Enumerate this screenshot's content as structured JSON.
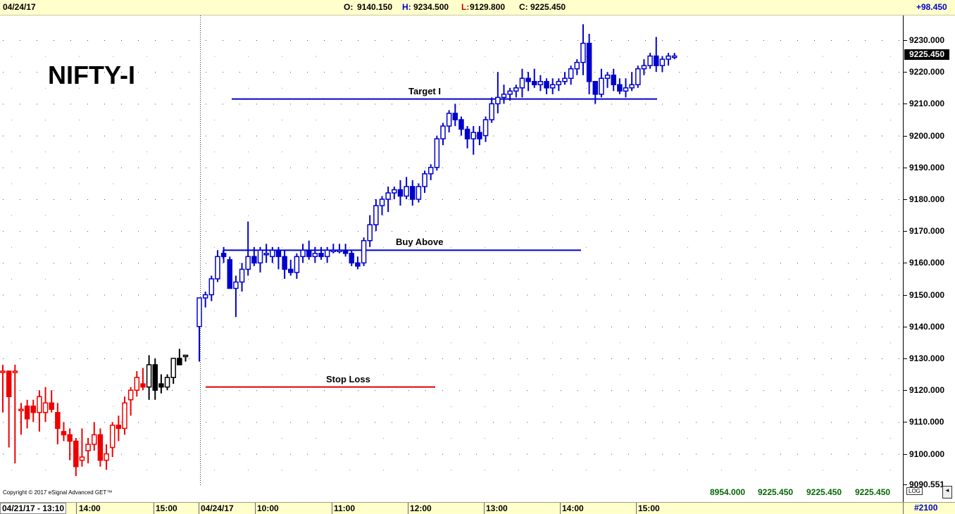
{
  "header": {
    "date": "04/24/17",
    "open_label": "O:",
    "open": "9140.150",
    "high_label": "H:",
    "high": "9234.500",
    "low_label": "L:",
    "low": "9129.800",
    "close_label": "C:",
    "close": "9225.450",
    "change": "+98.450"
  },
  "symbol": "NIFTY-I",
  "copyright": "Copyright © 2017 eSignal Advanced GET™",
  "price_flag": "9225.450",
  "bottom_values": [
    "8954.000",
    "9225.450",
    "9225.450",
    "9225.450"
  ],
  "log_label": "LOG",
  "bar_count": "#2100",
  "time_axis": {
    "start": "04/21/17 - 13:10",
    "labels": [
      "14:00",
      "15:00",
      "04/24/17",
      "10:00",
      "11:00",
      "12:00",
      "13:00",
      "14:00",
      "15:00"
    ]
  },
  "chart_data": {
    "type": "candlestick",
    "ylim": [
      9090.551,
      9235
    ],
    "yticks": [
      "9230.000",
      "9220.000",
      "9210.000",
      "9200.000",
      "9190.000",
      "9180.000",
      "9170.000",
      "9160.000",
      "9150.000",
      "9140.000",
      "9130.000",
      "9120.000",
      "9110.000",
      "9100.000",
      "9090.551"
    ],
    "annotations": [
      {
        "label": "Target I",
        "price": 9211.5,
        "color": "#0000cc"
      },
      {
        "label": "Buy Above",
        "price": 9164,
        "color": "#0000cc"
      },
      {
        "label": "Stop Loss",
        "price": 9121,
        "color": "#dd0000"
      }
    ],
    "day1_color": "#ee0000",
    "day1_late_color": "#000000",
    "day2_color": "#0000cc",
    "day1": [
      [
        9126,
        9128,
        9113,
        9126
      ],
      [
        9126,
        9126,
        9102,
        9118
      ],
      [
        9126,
        9128,
        9097,
        9126
      ],
      [
        9114,
        9116,
        9106,
        9114
      ],
      [
        9115,
        9117,
        9108,
        9111
      ],
      [
        9115,
        9117,
        9110,
        9113
      ],
      [
        9113,
        9120,
        9107,
        9118
      ],
      [
        9113,
        9121,
        9110,
        9116
      ],
      [
        9116,
        9120,
        9113,
        9114
      ],
      [
        9113,
        9116,
        9103,
        9108
      ],
      [
        9107,
        9110,
        9104,
        9106
      ],
      [
        9106,
        9108,
        9098,
        9104
      ],
      [
        9104,
        9105,
        9093,
        9096
      ],
      [
        9098,
        9108,
        9096,
        9099
      ],
      [
        9101,
        9105,
        9097,
        9103
      ],
      [
        9103,
        9110,
        9101,
        9106
      ],
      [
        9106,
        9108,
        9096,
        9098
      ],
      [
        9098,
        9103,
        9095,
        9100
      ],
      [
        9102,
        9110,
        9099,
        9109
      ],
      [
        9109,
        9112,
        9104,
        9108
      ],
      [
        9108,
        9118,
        9106,
        9116
      ],
      [
        9117,
        9121,
        9112,
        9120
      ],
      [
        9120,
        9126,
        9118,
        9124
      ],
      [
        9122,
        9127,
        9120,
        9121
      ],
      [
        9121,
        9131,
        9117,
        9128
      ],
      [
        9128,
        9130,
        9117,
        9120
      ],
      [
        9122,
        9125,
        9119,
        9121
      ],
      [
        9121,
        9125,
        9120,
        9124
      ],
      [
        9124,
        9130,
        9122,
        9130
      ],
      [
        9130,
        9133,
        9128,
        9128
      ],
      [
        9131,
        9131,
        9129,
        9131
      ]
    ],
    "day2": [
      [
        9140,
        9149,
        9129,
        9149
      ],
      [
        9149,
        9151,
        9146,
        9150
      ],
      [
        9150,
        9156,
        9148,
        9155
      ],
      [
        9155,
        9164,
        9154,
        9162
      ],
      [
        9163,
        9165,
        9160,
        9162
      ],
      [
        9161,
        9162,
        9152,
        9152
      ],
      [
        9152,
        9156,
        9143,
        9154
      ],
      [
        9154,
        9160,
        9151,
        9158
      ],
      [
        9158,
        9173,
        9156,
        9162
      ],
      [
        9162,
        9165,
        9159,
        9160
      ],
      [
        9160,
        9165,
        9157,
        9164
      ],
      [
        9163,
        9166,
        9160,
        9163
      ],
      [
        9162,
        9165,
        9160,
        9164
      ],
      [
        9164,
        9165,
        9158,
        9162
      ],
      [
        9162,
        9164,
        9155,
        9158
      ],
      [
        9158,
        9161,
        9156,
        9157
      ],
      [
        9157,
        9163,
        9155,
        9162
      ],
      [
        9162,
        9166,
        9160,
        9164
      ],
      [
        9164,
        9167,
        9161,
        9162
      ],
      [
        9162,
        9165,
        9160,
        9163
      ],
      [
        9163,
        9165,
        9161,
        9162
      ],
      [
        9162,
        9165,
        9160,
        9164
      ],
      [
        9164,
        9166,
        9163,
        9164
      ],
      [
        9164,
        9166,
        9163,
        9164
      ],
      [
        9164,
        9166,
        9162,
        9163
      ],
      [
        9163,
        9164,
        9159,
        9160
      ],
      [
        9160,
        9162,
        9158,
        9159
      ],
      [
        9160,
        9168,
        9159,
        9167
      ],
      [
        9167,
        9175,
        9165,
        9172
      ],
      [
        9172,
        9180,
        9170,
        9178
      ],
      [
        9178,
        9181,
        9175,
        9180
      ],
      [
        9180,
        9184,
        9176,
        9182
      ],
      [
        9182,
        9184,
        9180,
        9183
      ],
      [
        9183,
        9186,
        9178,
        9181
      ],
      [
        9181,
        9187,
        9180,
        9184
      ],
      [
        9184,
        9186,
        9178,
        9180
      ],
      [
        9180,
        9185,
        9179,
        9184
      ],
      [
        9184,
        9189,
        9182,
        9188
      ],
      [
        9188,
        9191,
        9186,
        9190
      ],
      [
        9190,
        9200,
        9189,
        9199
      ],
      [
        9199,
        9204,
        9197,
        9203
      ],
      [
        9203,
        9208,
        9201,
        9207
      ],
      [
        9207,
        9210,
        9203,
        9205
      ],
      [
        9205,
        9206,
        9200,
        9202
      ],
      [
        9202,
        9203,
        9196,
        9199
      ],
      [
        9199,
        9203,
        9194,
        9201
      ],
      [
        9201,
        9203,
        9197,
        9199
      ],
      [
        9200,
        9206,
        9198,
        9205
      ],
      [
        9205,
        9212,
        9204,
        9210
      ],
      [
        9210,
        9220,
        9207,
        9212
      ],
      [
        9212,
        9216,
        9210,
        9213
      ],
      [
        9213,
        9215,
        9211,
        9214
      ],
      [
        9214,
        9216,
        9212,
        9215
      ],
      [
        9215,
        9221,
        9212,
        9218
      ],
      [
        9218,
        9220,
        9214,
        9217
      ],
      [
        9217,
        9221,
        9215,
        9216
      ],
      [
        9216,
        9219,
        9214,
        9217
      ],
      [
        9217,
        9218,
        9213,
        9215
      ],
      [
        9215,
        9218,
        9213,
        9216
      ],
      [
        9216,
        9218,
        9214,
        9217
      ],
      [
        9217,
        9220,
        9216,
        9218
      ],
      [
        9218,
        9222,
        9216,
        9221
      ],
      [
        9221,
        9224,
        9219,
        9223
      ],
      [
        9223,
        9235,
        9219,
        9229
      ],
      [
        9229,
        9232,
        9213,
        9217
      ],
      [
        9217,
        9217,
        9210,
        9213
      ],
      [
        9213,
        9221,
        9212,
        9218
      ],
      [
        9218,
        9220,
        9215,
        9219
      ],
      [
        9219,
        9221,
        9214,
        9216
      ],
      [
        9216,
        9218,
        9213,
        9214
      ],
      [
        9214,
        9218,
        9212,
        9215
      ],
      [
        9215,
        9220,
        9214,
        9216
      ],
      [
        9216,
        9222,
        9215,
        9221
      ],
      [
        9221,
        9224,
        9219,
        9222
      ],
      [
        9222,
        9226,
        9221,
        9225
      ],
      [
        9225,
        9231,
        9220,
        9222
      ],
      [
        9222,
        9225,
        9220,
        9224
      ],
      [
        9224,
        9226,
        9222,
        9225
      ],
      [
        9225,
        9226,
        9224,
        9225
      ]
    ]
  }
}
